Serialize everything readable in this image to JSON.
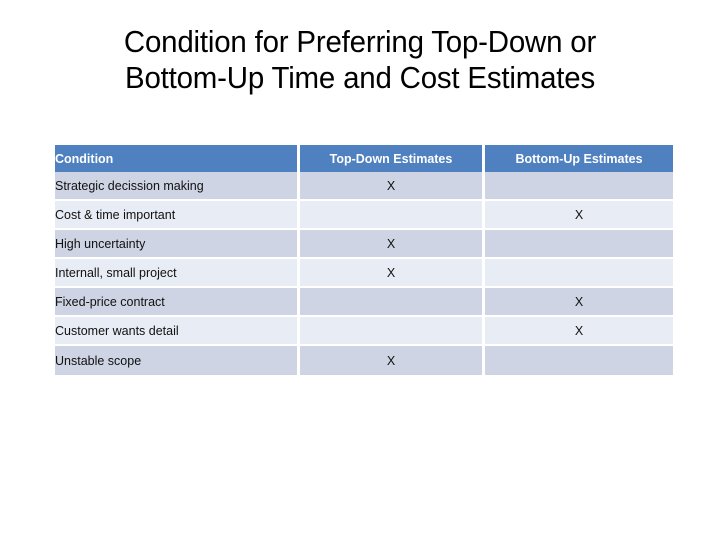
{
  "slide": {
    "title_line1": "Condition for Preferring Top-Down or",
    "title_line2": "Bottom-Up Time and Cost Estimates"
  },
  "colors": {
    "header_background": "#4f80c0",
    "header_text": "#ffffff",
    "row_dark": "#ced4e3",
    "row_light": "#e8ecf4",
    "body_text": "#111111",
    "page_background": "#ffffff"
  },
  "table": {
    "headers": [
      "Condition",
      "Top-Down Estimates",
      "Bottom-Up Estimates"
    ],
    "mark": "X",
    "rows": [
      {
        "condition": "Strategic decission making",
        "top_down": "X",
        "bottom_up": "",
        "shade": "row-dark"
      },
      {
        "condition": "Cost & time important",
        "top_down": "",
        "bottom_up": "X",
        "shade": "row-light"
      },
      {
        "condition": "High uncertainty",
        "top_down": "X",
        "bottom_up": "",
        "shade": "row-dark"
      },
      {
        "condition": "Internall, small project",
        "top_down": "X",
        "bottom_up": "",
        "shade": "row-light"
      },
      {
        "condition": "Fixed-price contract",
        "top_down": "",
        "bottom_up": "X",
        "shade": "row-dark"
      },
      {
        "condition": "Customer wants detail",
        "top_down": "",
        "bottom_up": "X",
        "shade": "row-light"
      },
      {
        "condition": "Unstable scope",
        "top_down": "X",
        "bottom_up": "",
        "shade": "row-dark"
      }
    ]
  }
}
